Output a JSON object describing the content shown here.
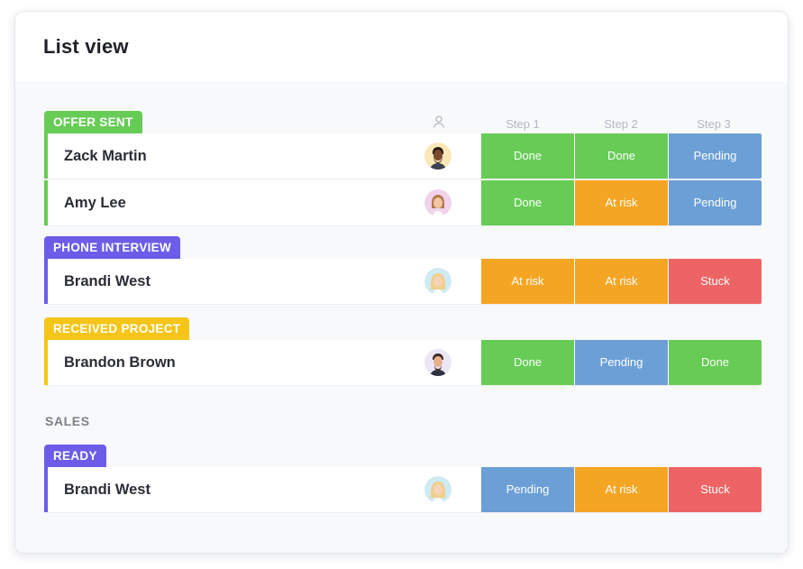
{
  "title": "List view",
  "columns": {
    "step1": "Step 1",
    "step2": "Step 2",
    "step3": "Step 3"
  },
  "colors": {
    "green": "#66cc55",
    "purple": "#6c5ce7",
    "yellow": "#f5c518",
    "Done": "#66cc55",
    "At risk": "#f5a524",
    "Pending": "#6b9fd6",
    "Stuck": "#ee6464"
  },
  "groups": [
    {
      "label": "OFFER SENT",
      "color": "green",
      "rows": [
        {
          "name": "Zack Martin",
          "avatar": "avatar-man-dark",
          "steps": [
            "Done",
            "Done",
            "Pending"
          ]
        },
        {
          "name": "Amy Lee",
          "avatar": "avatar-woman-light",
          "steps": [
            "Done",
            "At risk",
            "Pending"
          ]
        }
      ]
    },
    {
      "label": "PHONE INTERVIEW",
      "color": "purple",
      "rows": [
        {
          "name": "Brandi West",
          "avatar": "avatar-woman-blonde",
          "steps": [
            "At risk",
            "At risk",
            "Stuck"
          ]
        }
      ]
    },
    {
      "label": "RECEIVED PROJECT",
      "color": "yellow",
      "rows": [
        {
          "name": "Brandon Brown",
          "avatar": "avatar-man-light",
          "steps": [
            "Done",
            "Pending",
            "Done"
          ]
        }
      ]
    }
  ],
  "section": {
    "label": "SALES",
    "groups": [
      {
        "label": "READY",
        "color": "purple",
        "rows": [
          {
            "name": "Brandi West",
            "avatar": "avatar-woman-blonde",
            "steps": [
              "Pending",
              "At risk",
              "Stuck"
            ]
          }
        ]
      }
    ]
  }
}
